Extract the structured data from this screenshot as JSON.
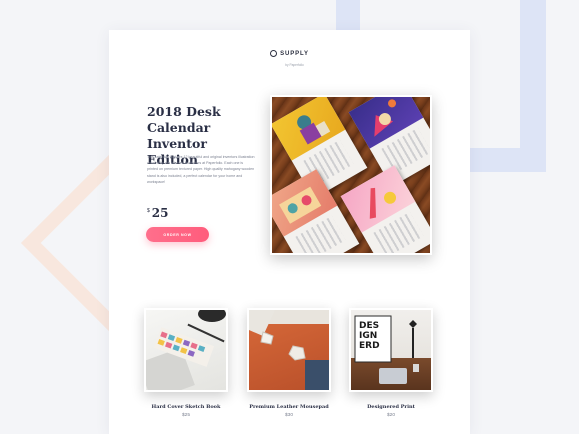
{
  "brand": {
    "name": "SUPPLY",
    "tagline": "by Paperfolio"
  },
  "hero": {
    "title": "2018 Desk\nCalendar\nInventor Edition",
    "description": "This calendar features 12 beautiful and original inventors illustration created by our talented illustrators at Paperfolio. Each one is printed on premium textured paper. High quality mahogany wooden stand is also included, a perfect calendar for your home and workspace!",
    "currency": "$",
    "price": "25",
    "order_label": "ORDER NOW"
  },
  "products": [
    {
      "name": "Hard Cover Sketch Book",
      "price": "$25"
    },
    {
      "name": "Premium Leather Mousepad",
      "price": "$30"
    },
    {
      "name": "Designered Print",
      "price": "$20"
    }
  ],
  "poster_text": "DES\nIGN\nERD",
  "colors": {
    "accent": "#ff6580",
    "title": "#2a2f45",
    "body_text": "#7b8090",
    "background": "#f4f5f8"
  }
}
